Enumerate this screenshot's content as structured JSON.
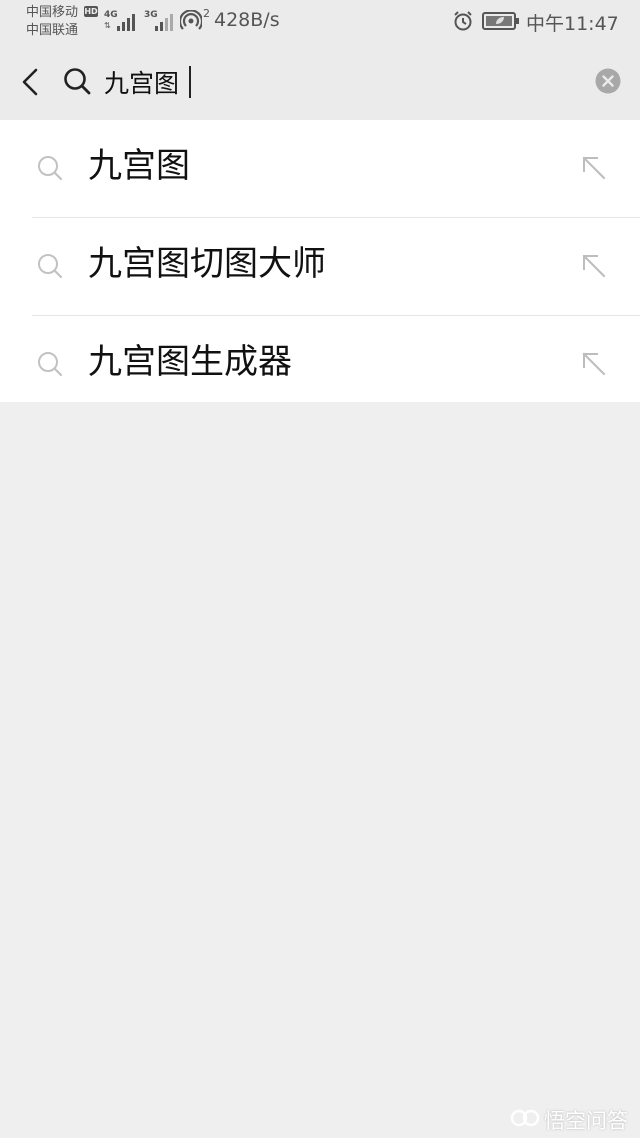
{
  "status_bar": {
    "carrier_1": "中国移动",
    "carrier_2": "中国联通",
    "hd_badge": "HD",
    "network_1": "4G",
    "network_2": "3G",
    "hotspot_count": "2",
    "speed": "428B/s",
    "time": "中午11:47",
    "icons": [
      "signal-icon",
      "hotspot-icon",
      "alarm-icon",
      "battery-icon"
    ]
  },
  "search": {
    "query": "九宫图",
    "icons": [
      "back-arrow-icon",
      "search-icon",
      "clear-icon"
    ]
  },
  "suggestions": [
    {
      "label": "九宫图"
    },
    {
      "label": "九宫图切图大师"
    },
    {
      "label": "九宫图生成器"
    }
  ],
  "watermark": {
    "text": "悟空问答"
  },
  "colors": {
    "page_background": "#efefef",
    "header_background": "#ebebeb",
    "list_background": "#ffffff",
    "icon_gray": "#bdbdbd",
    "text_dark": "#111111"
  }
}
